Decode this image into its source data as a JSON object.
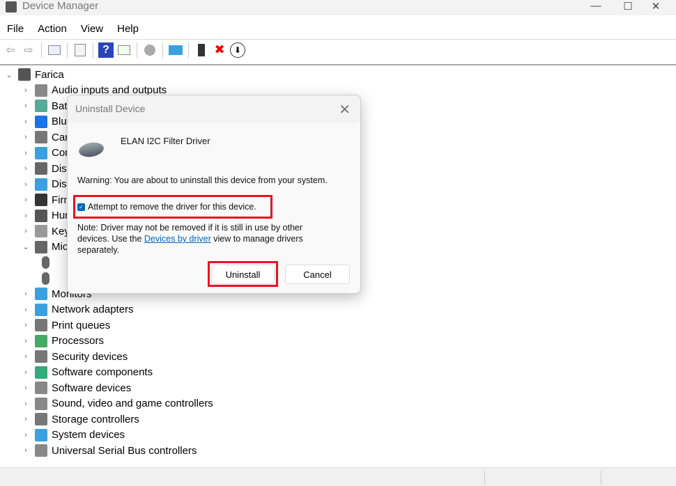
{
  "window": {
    "title": "Device Manager",
    "minimize": "—",
    "maximize": "☐",
    "close": "✕"
  },
  "menu": [
    "File",
    "Action",
    "View",
    "Help"
  ],
  "toolbar": {
    "back": "⇦",
    "forward": "⇨",
    "help": "?",
    "remove": "✖",
    "download": "⬇"
  },
  "tree": {
    "root": "Farica",
    "items": [
      {
        "label": "Audio inputs and outputs",
        "color": "#888"
      },
      {
        "label": "Batteries",
        "color": "#5a9"
      },
      {
        "label": "Bluetooth",
        "color": "#1a73e8"
      },
      {
        "label": "Cameras",
        "color": "#777"
      },
      {
        "label": "Computer",
        "color": "#3aa0e0"
      },
      {
        "label": "Disk drives",
        "color": "#666"
      },
      {
        "label": "Display adapters",
        "color": "#3aa0e0"
      },
      {
        "label": "Firmware",
        "color": "#333"
      },
      {
        "label": "Human Interface Devices",
        "color": "#555"
      },
      {
        "label": "Keyboards",
        "color": "#999"
      },
      {
        "label": "Mice and other pointing devices",
        "color": "#666",
        "expanded": true
      },
      {
        "label": "",
        "color": "#666",
        "child": true
      },
      {
        "label": "",
        "color": "#666",
        "child": true
      },
      {
        "label": "Monitors",
        "color": "#3aa0e0"
      },
      {
        "label": "Network adapters",
        "color": "#3aa0e0"
      },
      {
        "label": "Print queues",
        "color": "#777"
      },
      {
        "label": "Processors",
        "color": "#4a6"
      },
      {
        "label": "Security devices",
        "color": "#777"
      },
      {
        "label": "Software components",
        "color": "#3a7"
      },
      {
        "label": "Software devices",
        "color": "#888"
      },
      {
        "label": "Sound, video and game controllers",
        "color": "#888"
      },
      {
        "label": "Storage controllers",
        "color": "#777"
      },
      {
        "label": "System devices",
        "color": "#3aa0e0"
      },
      {
        "label": "Universal Serial Bus controllers",
        "color": "#888"
      }
    ]
  },
  "dialog": {
    "title": "Uninstall Device",
    "close": "✕",
    "device": "ELAN I2C Filter Driver",
    "warning": "Warning: You are about to uninstall this device from your system.",
    "checkbox_label": "Attempt to remove the driver for this device.",
    "checkbox_checked": true,
    "note_pre": "Note: Driver may not be removed if it is still in use by other devices. Use the ",
    "note_link": "Devices by driver",
    "note_post": " view to manage drivers separately.",
    "uninstall": "Uninstall",
    "cancel": "Cancel"
  }
}
